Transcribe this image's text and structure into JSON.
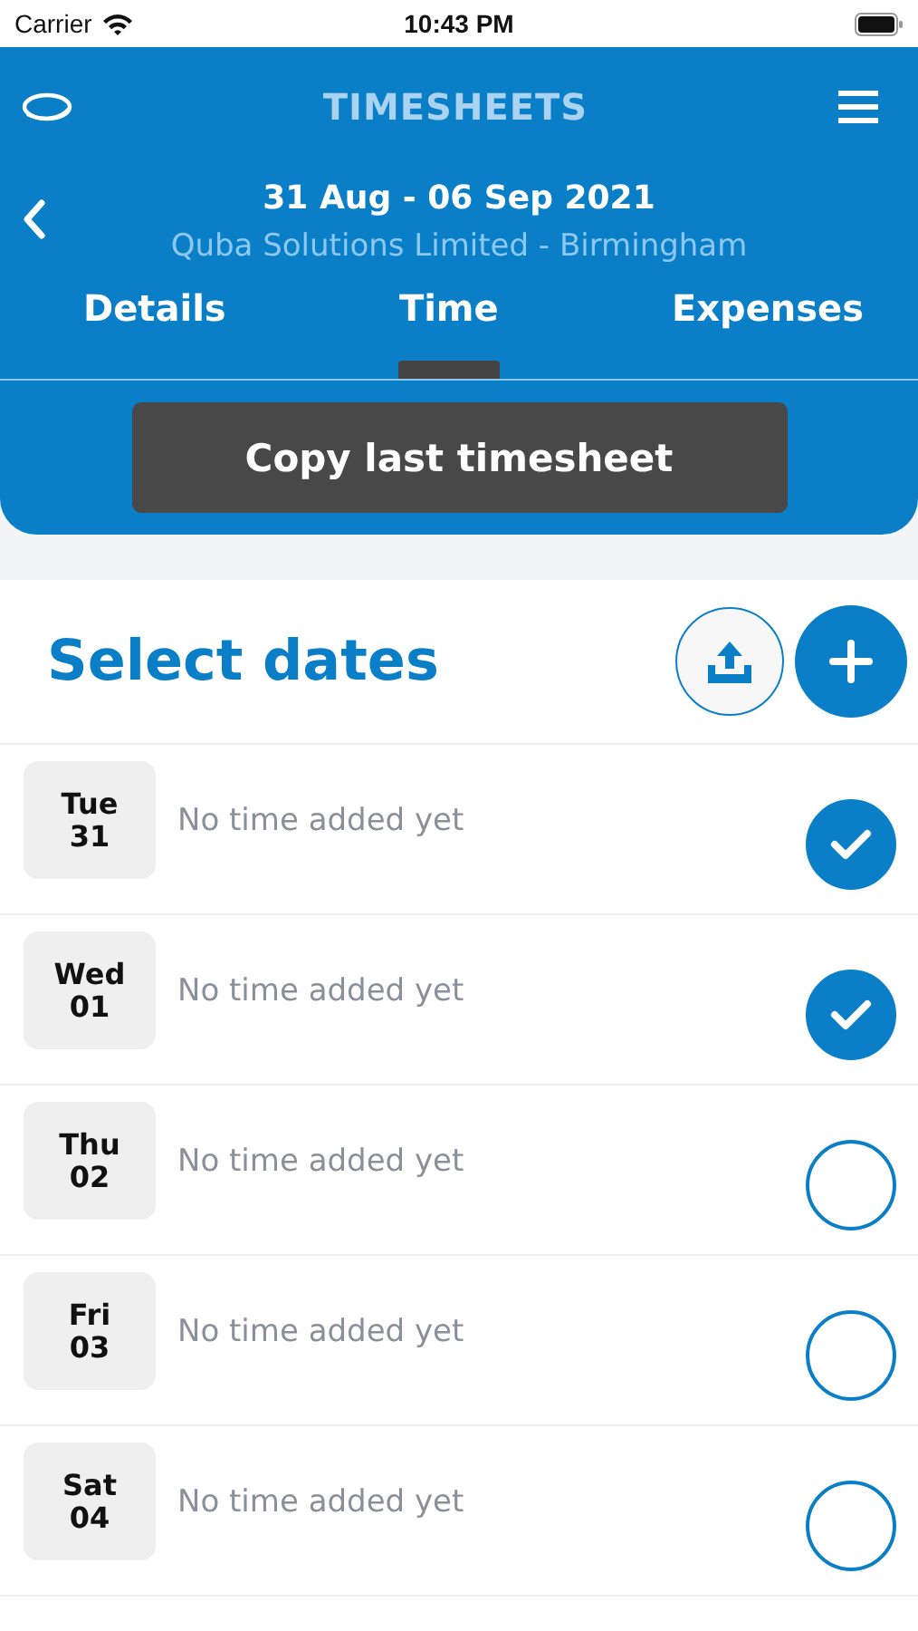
{
  "status_bar": {
    "carrier": "Carrier",
    "time": "10:43 PM"
  },
  "header": {
    "title": "TIMESHEETS",
    "period": "31 Aug - 06 Sep 2021",
    "client": "Quba Solutions Limited - Birmingham"
  },
  "tabs": [
    {
      "label": "Details",
      "selected": false
    },
    {
      "label": "Time",
      "selected": true
    },
    {
      "label": "Expenses",
      "selected": false
    }
  ],
  "copy_button": "Copy last timesheet",
  "section_title": "Select dates",
  "days": [
    {
      "weekday": "Tue",
      "day": "31",
      "note": "No time added yet",
      "selected": true
    },
    {
      "weekday": "Wed",
      "day": "01",
      "note": "No time added yet",
      "selected": true
    },
    {
      "weekday": "Thu",
      "day": "02",
      "note": "No time added yet",
      "selected": false
    },
    {
      "weekday": "Fri",
      "day": "03",
      "note": "No time added yet",
      "selected": false
    },
    {
      "weekday": "Sat",
      "day": "04",
      "note": "No time added yet",
      "selected": false
    }
  ]
}
